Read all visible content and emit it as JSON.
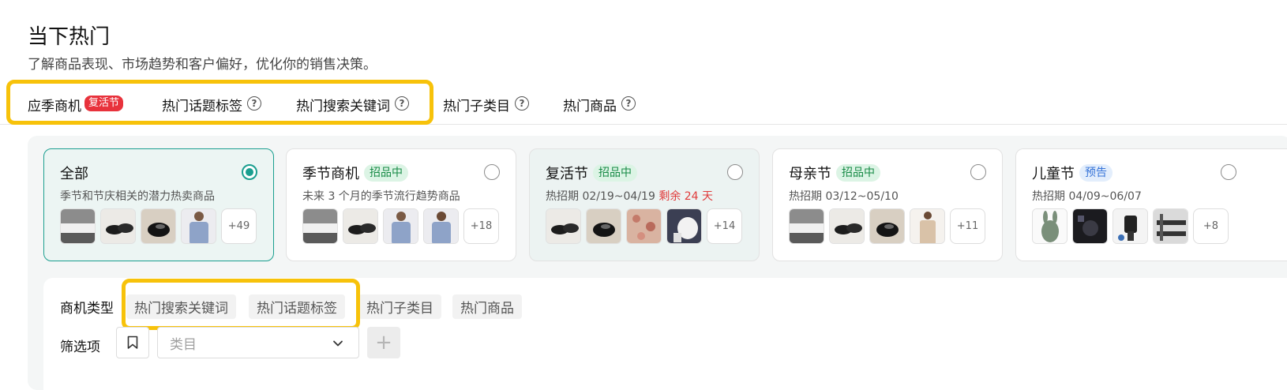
{
  "header": {
    "title": "当下热门",
    "subtitle": "了解商品表现、市场趋势和客户偏好，优化你的销售决策。"
  },
  "tabs": [
    {
      "label": "应季商机",
      "badge": "复活节",
      "active": true
    },
    {
      "label": "热门话题标签",
      "help": "?"
    },
    {
      "label": "热门搜索关键词",
      "help": "?"
    },
    {
      "label": "热门子类目",
      "help": "?"
    },
    {
      "label": "热门商品",
      "help": "?"
    }
  ],
  "cards": [
    {
      "title": "全部",
      "status": "",
      "desc": "季节和节庆相关的潜力热卖商品",
      "more": "+49",
      "selected": true
    },
    {
      "title": "季节商机",
      "status": "招品中",
      "desc": "未来 3 个月的季节流行趋势商品",
      "more": "+18"
    },
    {
      "title": "复活节",
      "status": "招品中",
      "desc": "热招期 02/19~04/19",
      "remaining": "剩余 24 天",
      "more": "+14"
    },
    {
      "title": "母亲节",
      "status": "招品中",
      "desc": "热招期 03/12~05/10",
      "more": "+11"
    },
    {
      "title": "儿童节",
      "status": "预告",
      "desc": "热招期 04/09~06/07",
      "more": "+8"
    }
  ],
  "filters": {
    "type_label": "商机类型",
    "type_options": [
      "热门搜索关键词",
      "热门话题标签",
      "热门子类目",
      "热门商品"
    ],
    "filter_label": "筛选项",
    "category_placeholder": "类目",
    "add_label": "+"
  },
  "colors": {
    "accent": "#1a9e8f",
    "highlight": "#f7c20a",
    "badge_red": "#e8323c",
    "status_green": "#168a45",
    "status_blue": "#3774d8"
  }
}
